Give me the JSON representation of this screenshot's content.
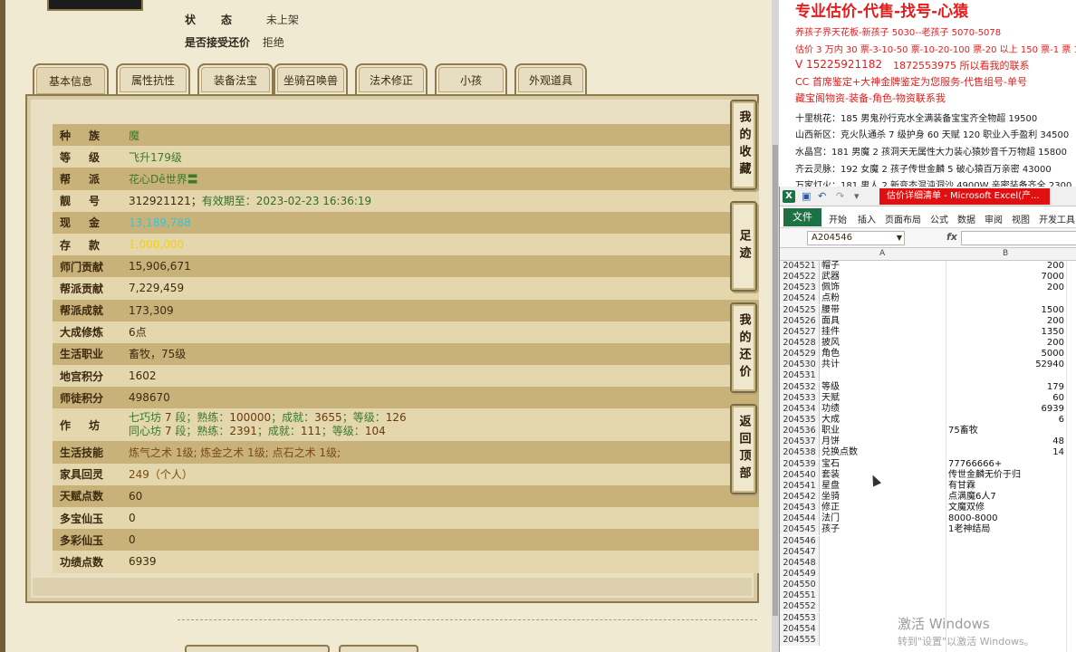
{
  "game": {
    "status_label": "状态",
    "status_value": "未上架",
    "bargain_label": "是否接受还价",
    "bargain_value": "拒绝",
    "tabs": [
      "基本信息",
      "属性抗性",
      "装备法宝",
      "坐骑召唤兽",
      "法术修正",
      "小孩",
      "外观道具"
    ],
    "active_tab": "基本信息",
    "rows": [
      {
        "k": "种族",
        "v": "魔"
      },
      {
        "k": "等级",
        "v": "飞升179级"
      },
      {
        "k": "帮派",
        "v": "花心Dê世界〓"
      },
      {
        "k": "靓号",
        "v": "312921121",
        "extra": "有效期至：2023-02-23 16:36:19"
      },
      {
        "k": "现金",
        "v": "13,189,788"
      },
      {
        "k": "存款",
        "v": "1,000,000"
      },
      {
        "k": "师门贡献",
        "v": "15,906,671"
      },
      {
        "k": "帮派贡献",
        "v": "7,229,459"
      },
      {
        "k": "帮派成就",
        "v": "173,309"
      },
      {
        "k": "大成修炼",
        "v": "6点"
      },
      {
        "k": "生活职业",
        "v": "畜牧，75级"
      },
      {
        "k": "地宫积分",
        "v": "1602"
      },
      {
        "k": "师徒积分",
        "v": "498670"
      },
      {
        "k": "作坊",
        "line1": [
          "七巧坊",
          "7",
          "段；熟练：",
          "100000",
          "；成就：",
          "3655",
          "；等级：",
          "126"
        ],
        "line2": [
          "同心坊",
          "7",
          "段；熟练：",
          "2391",
          "；成就：",
          "111",
          "；等级：",
          "104"
        ]
      },
      {
        "k": "生活技能",
        "v": "炼气之术 1级; 炼金之术 1级; 点石之术 1级;"
      },
      {
        "k": "家具回灵",
        "v": "249（个人）"
      },
      {
        "k": "天赋点数",
        "v": "60"
      },
      {
        "k": "多宝仙玉",
        "v": "0"
      },
      {
        "k": "多彩仙玉",
        "v": "0"
      },
      {
        "k": "功绩点数",
        "v": "6939"
      }
    ],
    "side_buttons": [
      "我的收藏",
      "足迹",
      "我的还价",
      "返回顶部"
    ]
  },
  "ads": {
    "title": "专业估价-代售-找号-心猿",
    "lines": [
      "养孩子界天花板-新孩子 5030--老孩子 5070-5078",
      "估价 3 万内 30 票-3-10-50 票-10-20-100 票-20 以上 150 票-1 票 1",
      "V 15225921182",
      "CC 首席鉴定+大神金牌鉴定为您服务-代售组号-单号",
      "藏宝阁物资-装备-角色-物资联系我",
      "十里桃花：185 男鬼孙行克水全满装备宝宝齐全物超 19500",
      "山西新区：克火队通杀 7 级护身 60 天赋 120 职业入手盈利 34500",
      "水晶宫：181 男魔 2 孩洞天无属性大力装心猿妙音千万物超 15800",
      "齐云灵脉：192 女魔 2 孩子传世金麟 5 破心猿百万亲密 43000",
      "万家灯火：181 男人 2 新变态混沌洞沙 4900W 亲密装备齐全 2300"
    ],
    "contact_overlay": "1872553975 所以看我的联系"
  },
  "excel": {
    "window_caption": "估价详细清单 - Microsoft Excel(产...",
    "ribbon_tabs": [
      "文件",
      "开始",
      "插入",
      "页面布局",
      "公式",
      "数据",
      "审阅",
      "视图",
      "开发工具"
    ],
    "name_box": "A204546",
    "fx": "fx",
    "col_headers": [
      "A",
      "B"
    ],
    "rows": [
      {
        "n": "204521",
        "a": "帽子",
        "b": "200",
        "num": true
      },
      {
        "n": "204522",
        "a": "武器",
        "b": "7000",
        "num": true
      },
      {
        "n": "204523",
        "a": "佩饰",
        "b": "200",
        "num": true
      },
      {
        "n": "204524",
        "a": "点粉",
        "b": "",
        "num": true
      },
      {
        "n": "204525",
        "a": "腰带",
        "b": "1500",
        "num": true
      },
      {
        "n": "204526",
        "a": "面具",
        "b": "200",
        "num": true
      },
      {
        "n": "204527",
        "a": "挂件",
        "b": "1350",
        "num": true
      },
      {
        "n": "204528",
        "a": "披风",
        "b": "200",
        "num": true
      },
      {
        "n": "204529",
        "a": "角色",
        "b": "5000",
        "num": true
      },
      {
        "n": "204530",
        "a": "共计",
        "b": "52940",
        "num": true
      },
      {
        "n": "204531",
        "a": "",
        "b": "",
        "num": true
      },
      {
        "n": "204532",
        "a": "等级",
        "b": "179",
        "num": true
      },
      {
        "n": "204533",
        "a": "天赋",
        "b": "60",
        "num": true
      },
      {
        "n": "204534",
        "a": "功绩",
        "b": "6939",
        "num": true
      },
      {
        "n": "204535",
        "a": "大成",
        "b": "6",
        "num": true
      },
      {
        "n": "204536",
        "a": "职业",
        "b": "75畜牧",
        "num": false
      },
      {
        "n": "204537",
        "a": "月饼",
        "b": "48",
        "num": true
      },
      {
        "n": "204538",
        "a": "兑换点数",
        "b": "14",
        "num": true
      },
      {
        "n": "204539",
        "a": "宝石",
        "b": "77766666+",
        "num": false
      },
      {
        "n": "204540",
        "a": "套装",
        "b": "传世金麟无价于归",
        "num": false
      },
      {
        "n": "204541",
        "a": "星盘",
        "b": "有甘霖",
        "num": false
      },
      {
        "n": "204542",
        "a": "坐骑",
        "b": "点满魔6人7",
        "num": false
      },
      {
        "n": "204543",
        "a": "修正",
        "b": "文魔双修",
        "num": false
      },
      {
        "n": "204544",
        "a": "法门",
        "b": "8000-8000",
        "num": false
      },
      {
        "n": "204545",
        "a": "孩子",
        "b": "1老神结局",
        "num": false
      },
      {
        "n": "204546",
        "a": "",
        "b": "",
        "num": false
      },
      {
        "n": "204547",
        "a": "",
        "b": "",
        "num": false
      },
      {
        "n": "204548",
        "a": "",
        "b": "",
        "num": false
      },
      {
        "n": "204549",
        "a": "",
        "b": "",
        "num": false
      },
      {
        "n": "204550",
        "a": "",
        "b": "",
        "num": false
      },
      {
        "n": "204551",
        "a": "",
        "b": "",
        "num": false
      },
      {
        "n": "204552",
        "a": "",
        "b": "",
        "num": false
      },
      {
        "n": "204553",
        "a": "",
        "b": "",
        "num": false
      },
      {
        "n": "204554",
        "a": "",
        "b": "",
        "num": false
      },
      {
        "n": "204555",
        "a": "",
        "b": "",
        "num": false
      }
    ]
  },
  "watermark": {
    "line1": "激活 Windows",
    "line2": "转到\"设置\"以激活 Windows。"
  }
}
